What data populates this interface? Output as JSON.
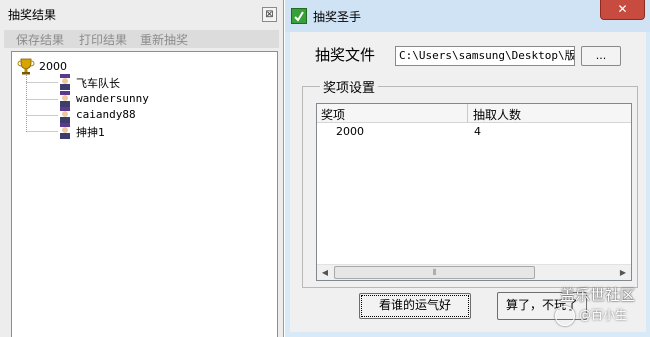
{
  "left_window": {
    "title": "抽奖结果",
    "close_glyph": "⊠",
    "menu": [
      "保存结果",
      "打印结果",
      "重新抽奖"
    ],
    "tree": {
      "root_label": "2000",
      "root_icon": "trophy-icon",
      "children": [
        "飞车队长",
        "wandersunny",
        "caiandy88",
        "抻抻1"
      ],
      "child_icon": "person-icon"
    }
  },
  "right_window": {
    "title": "抽奖圣手",
    "close_glyph": "✕",
    "file_label": "抽奖文件",
    "file_path": "C:\\Users\\samsung\\Desktop\\版块",
    "browse_label": "...",
    "group_title": "奖项设置",
    "columns": [
      "奖项",
      "抽取人数"
    ],
    "rows": [
      {
        "prize": "2000",
        "count": "4"
      }
    ],
    "draw_button": "看谁的运气好",
    "quit_button": "算了，不玩了"
  },
  "watermark": {
    "line1": "盖乐世社区",
    "line2": "@百小生"
  },
  "colors": {
    "caption": "#cfe3f5",
    "close_button": "#c84b3f",
    "app_icon": "#38a038"
  }
}
